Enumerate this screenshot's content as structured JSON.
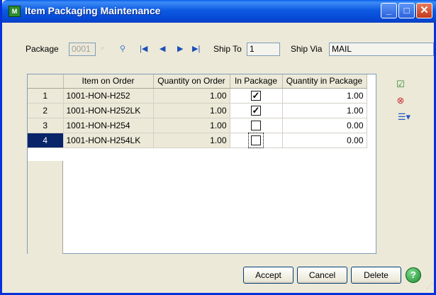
{
  "window": {
    "title": "Item Packaging Maintenance",
    "app_icon_text": "M",
    "minimize_glyph": "_",
    "maximize_glyph": "□",
    "close_glyph": "✕"
  },
  "header": {
    "package_label": "Package",
    "package_value": "0001",
    "ship_to_label": "Ship To",
    "ship_to_value": "1",
    "ship_via_label": "Ship Via",
    "ship_via_value": "MAIL"
  },
  "nav_icons": [
    "first-record-icon",
    "previous-record-icon",
    "next-record-icon",
    "last-record-icon"
  ],
  "grid": {
    "columns": [
      "",
      "Item on Order",
      "Quantity on Order",
      "In Package",
      "Quantity in Package"
    ],
    "rows": [
      {
        "num": "1",
        "item": "1001-HON-H252",
        "qty_order": "1.00",
        "in_package": true,
        "qty_package": "1.00"
      },
      {
        "num": "2",
        "item": "1001-HON-H252LK",
        "qty_order": "1.00",
        "in_package": true,
        "qty_package": "1.00"
      },
      {
        "num": "3",
        "item": "1001-HON-H254",
        "qty_order": "1.00",
        "in_package": false,
        "qty_package": "0.00"
      },
      {
        "num": "4",
        "item": "1001-HON-H254LK",
        "qty_order": "1.00",
        "in_package": false,
        "qty_package": "0.00"
      }
    ],
    "selected_row": 3
  },
  "buttons": {
    "accept": "Accept",
    "cancel": "Cancel",
    "delete": "Delete",
    "help": "?"
  },
  "colors": {
    "title_bar": "#0a5fe9",
    "selected_row": "#0a246a",
    "window_bg": "#ece9d8"
  }
}
